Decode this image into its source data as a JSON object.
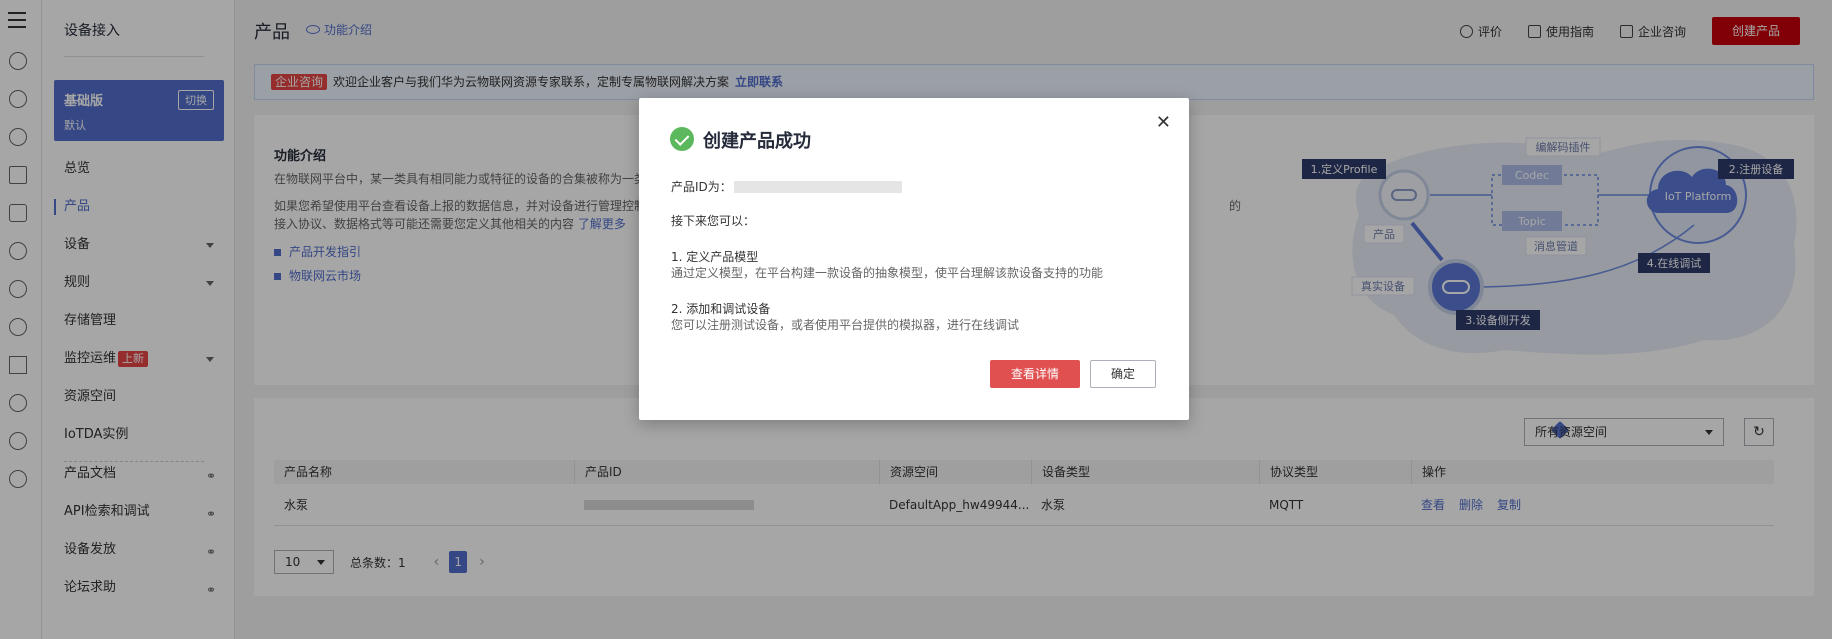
{
  "sidebar": {
    "title": "设备接入",
    "edition": {
      "name": "基础版",
      "switch_label": "切换",
      "desc": "默认"
    },
    "items": [
      {
        "label": "总览"
      },
      {
        "label": "产品"
      },
      {
        "label": "设备"
      },
      {
        "label": "规则"
      },
      {
        "label": "存储管理"
      },
      {
        "label": "监控运维",
        "badge": "上新"
      },
      {
        "label": "资源空间"
      },
      {
        "label": "IoTDA实例"
      },
      {
        "label": "产品文档"
      },
      {
        "label": "API检索和调试"
      },
      {
        "label": "设备发放"
      },
      {
        "label": "论坛求助"
      }
    ]
  },
  "header": {
    "title": "产品",
    "intro_link": "功能介绍",
    "actions": {
      "rate": "评价",
      "guide": "使用指南",
      "consult": "企业咨询",
      "create": "创建产品"
    }
  },
  "banner": {
    "tag": "企业咨询",
    "text": "欢迎企业客户与我们华为云物联网资源专家联系，定制专属物联网解决方案",
    "link": "立即联系"
  },
  "intro": {
    "title": "功能介绍",
    "p1": "在物联网平台中，某一类具有相同能力或特征的设备的合集被称为一类",
    "p2": "如果您希望使用平台查看设备上报的数据信息，并对设备进行管理控制",
    "p2_tail": "的",
    "p3": "接入协议、数据格式等可能还需要您定义其他相关的内容",
    "more": "了解更多",
    "links": [
      "产品开发指引",
      "物联网云市场"
    ]
  },
  "diagram": {
    "labels": {
      "profile": "1.定义Profile",
      "register": "2.注册设备",
      "device_dev": "3.设备侧开发",
      "online_debug": "4.在线调试",
      "codec_plugin": "编解码插件",
      "codec": "Codec",
      "topic": "Topic",
      "message": "消息管道",
      "product": "产品",
      "real_device": "真实设备",
      "platform": "IoT Platform"
    }
  },
  "list": {
    "space_select": "所有资源空间",
    "columns": [
      "产品名称",
      "产品ID",
      "资源空间",
      "设备类型",
      "协议类型",
      "操作"
    ],
    "rows": [
      {
        "name": "水泵",
        "space": "DefaultApp_hw49944...",
        "device_type": "水泵",
        "protocol": "MQTT",
        "ops": [
          "查看",
          "删除",
          "复制"
        ]
      }
    ],
    "pager": {
      "size": "10",
      "total_label": "总条数：1",
      "page": "1"
    }
  },
  "dialog": {
    "title": "创建产品成功",
    "id_label": "产品ID为：",
    "next": "接下来您可以：",
    "step1_title": "1. 定义产品模型",
    "step1_desc": "通过定义模型，在平台构建一款设备的抽象模型，使平台理解该款设备支持的功能",
    "step2_title": "2. 添加和调试设备",
    "step2_desc": "您可以注册测试设备，或者使用平台提供的模拟器，进行在线调试",
    "view_details": "查看详情",
    "confirm": "确定"
  }
}
